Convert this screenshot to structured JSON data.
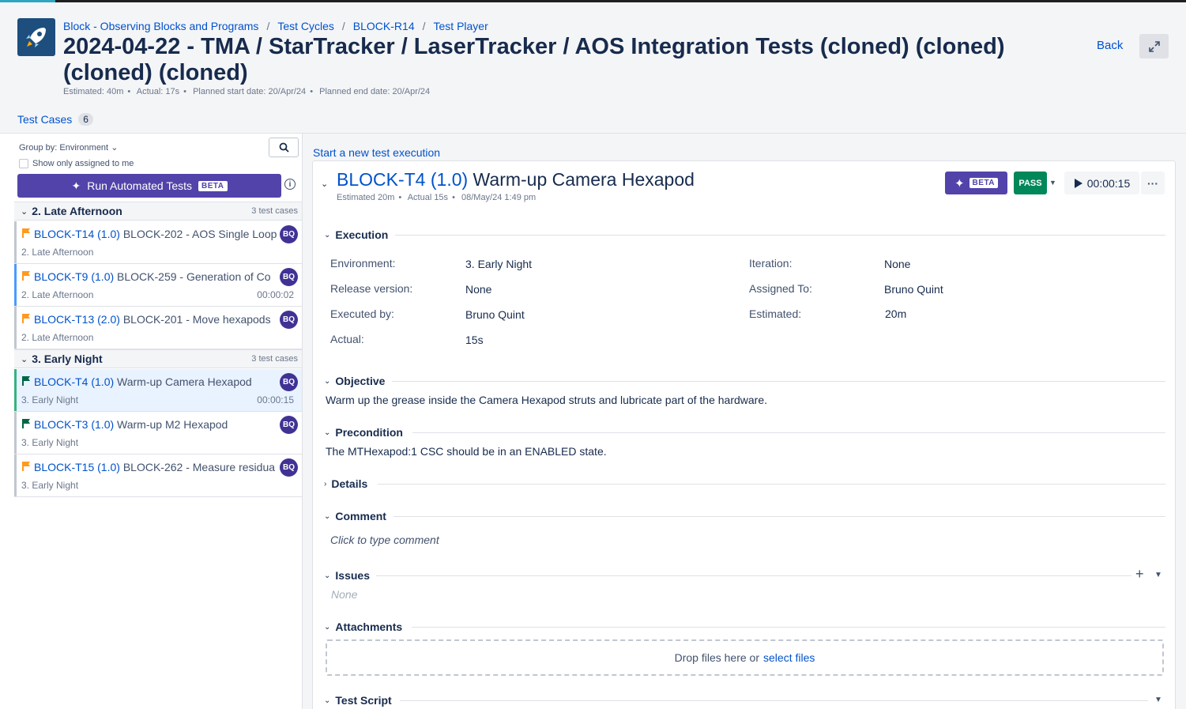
{
  "breadcrumb": [
    "Block - Observing Blocks and Programs",
    "Test Cycles",
    "BLOCK-R14",
    "Test Player"
  ],
  "header": {
    "title": "2024-04-22 - TMA / StarTracker / LaserTracker / AOS Integration Tests (cloned) (cloned) (cloned) (cloned)",
    "meta": [
      "Estimated: 40m",
      "Actual: 17s",
      "Planned start date: 20/Apr/24",
      "Planned end date: 20/Apr/24"
    ],
    "back_label": "Back"
  },
  "tabs": {
    "label": "Test Cases",
    "count": "6"
  },
  "sidebar": {
    "group_by": "Group by: Environment",
    "assigned_label": "Show only assigned to me",
    "run_label": "Run Automated Tests",
    "beta": "BETA",
    "groups": [
      {
        "name": "2. Late Afternoon",
        "count": "3 test cases"
      },
      {
        "name": "3. Early Night",
        "count": "3 test cases"
      }
    ],
    "cases": [
      {
        "key": "BLOCK-T14 (1.0)",
        "title": "BLOCK-202 - AOS Single Loop",
        "env": "2. Late Afternoon",
        "time": "",
        "avatar": "BQ"
      },
      {
        "key": "BLOCK-T9 (1.0)",
        "title": "BLOCK-259 - Generation of Co",
        "env": "2. Late Afternoon",
        "time": "00:00:02",
        "avatar": "BQ"
      },
      {
        "key": "BLOCK-T13 (2.0)",
        "title": "BLOCK-201 - Move hexapods",
        "env": "2. Late Afternoon",
        "time": "",
        "avatar": "BQ"
      },
      {
        "key": "BLOCK-T4 (1.0)",
        "title": "Warm-up Camera Hexapod",
        "env": "3. Early Night",
        "time": "00:00:15",
        "avatar": "BQ"
      },
      {
        "key": "BLOCK-T3 (1.0)",
        "title": "Warm-up M2 Hexapod",
        "env": "3. Early Night",
        "time": "",
        "avatar": "BQ"
      },
      {
        "key": "BLOCK-T15 (1.0)",
        "title": "BLOCK-262 - Measure residua",
        "env": "3. Early Night",
        "time": "",
        "avatar": "BQ"
      }
    ]
  },
  "main": {
    "start_link": "Start a new test execution",
    "exec_key": "BLOCK-T4 (1.0)",
    "exec_title": "Warm-up Camera Hexapod",
    "exec_meta": [
      "Estimated 20m",
      "Actual 15s",
      "08/May/24 1:49 pm"
    ],
    "beta": "BETA",
    "status": "PASS",
    "timer": "00:00:15",
    "sections": {
      "execution": "Execution",
      "objective": "Objective",
      "precondition": "Precondition",
      "details": "Details",
      "comment": "Comment",
      "issues": "Issues",
      "attachments": "Attachments",
      "test_script": "Test Script"
    },
    "fields": {
      "environment_label": "Environment:",
      "environment": "3. Early Night",
      "release_label": "Release version:",
      "release": "None",
      "executed_by_label": "Executed by:",
      "executed_by": "Bruno Quint",
      "actual_label": "Actual:",
      "actual": "15s",
      "iteration_label": "Iteration:",
      "iteration": "None",
      "assigned_label": "Assigned To:",
      "assigned": "Bruno Quint",
      "estimated_label": "Estimated:",
      "estimated": "20m"
    },
    "objective_text": "Warm up the grease inside the Camera Hexapod struts and lubricate part of the hardware.",
    "precondition_text": "The MTHexapod:1 CSC should be in an ENABLED state.",
    "comment_placeholder": "Click to type comment",
    "issues_none": "None",
    "drop_text": "Drop files here or",
    "select_files": "select files"
  },
  "colors": {
    "accent": "#5243aa",
    "link": "#0052cc",
    "pass": "#00875a",
    "flag_orange": "#ff991f",
    "flag_green": "#006644"
  }
}
